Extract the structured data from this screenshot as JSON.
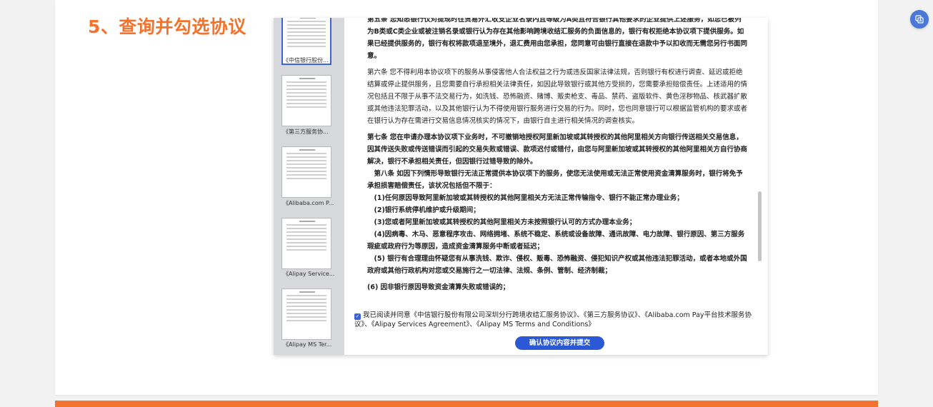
{
  "step": {
    "title": "5、查询并勾选协议"
  },
  "thumbnails": [
    {
      "caption": "《中信银行股份...",
      "selected": true
    },
    {
      "caption": "《第三方服务协...",
      "selected": false
    },
    {
      "caption": "《Alibaba.com P...",
      "selected": false
    },
    {
      "caption": "《Alipay Service...",
      "selected": false
    },
    {
      "caption": "《Alipay MS Ter...",
      "selected": false
    }
  ],
  "document": {
    "paragraphs": [
      {
        "text": "第五条 您知悉银行仅对提现时往贸易外汇收支企业名录内且等级为A类且符合银行其他要求的企业提供上述服务，如您已被列为B类或C类企业或被注销名录或银行认为存在其他影响跨境收结汇服务的负面信息的，银行有权拒绝本协议项下提供服务。如果已经提供服务的，银行有权将款项退至境外，退汇费用由您承担，您同意可由银行直接在退款中予以扣收而无需您另行书面同意。",
        "bold": true
      },
      {
        "text": "第六条 您不得利用本协议项下的服务从事侵害他人合法权益之行为或违反国家法律法规，否则银行有权进行调查、延迟或拒绝结算或停止提供服务，且您需要自行承担相关法律责任，如因此导致银行或其他方受损的，您需要承担赔偿责任。上述适用的情况包括且不限于从事不法交易行为，如洗钱、恐怖融资、赌博、贩卖枪支、毒品、禁药、盗版软件、黄色淫秽物品、核武器扩散或其他违法犯罪活动，以及其他银行认为不得使用银行服务进行交易的行为。同时，您也同意银行可以根据监管机构的要求或者在银行认为存在需进行交易信息情况核实的情况下，由银行自主进行相关情况的调查核实。",
        "bold": false
      },
      {
        "text": "第七条 您在申请办理本协议项下业务时，不可撤销地授权阿里新加坡或其转授权的其他阿里相关方向银行传送相关交易信息，因其传送失败或传送错误而引起的交易失败或错误、款项迟付或错付，由您与阿里新加坡或其转授权的其他阿里相关方自行协商解决，银行不承担相关责任，但因银行过错导致的除外。",
        "bold": true
      },
      {
        "text": "　第八条 如因下列情形导致银行无法正常提供本协议项下的服务，使您无法使用或无法正常使用资金清算服务时，银行将免予承担损害赔偿责任，该状况包括但不限于：",
        "bold": true
      },
      {
        "text": "　(1)任何原因导致阿里新加坡或其转授权的其他阿里相关方无法正常传输指令、银行不能正常办理业务；",
        "bold": true
      },
      {
        "text": "　(2)银行系统停机维护或升级期间；",
        "bold": true
      },
      {
        "text": "　(3)您或者阿里新加坡或其转授权的其他阿里相关方未按照银行认可的方式办理本业务；",
        "bold": true
      },
      {
        "text": "　(4)因病毒、木马、恶意程序攻击、网络拥堵、系统不稳定、系统或设备故障、通讯故障、电力故障、银行原因、第三方服务瑕疵或政府行为等原因，造成资金清算服务中断或者延迟；",
        "bold": true
      },
      {
        "text": "　(5) 银行有合理理由怀疑您有从事洗钱、欺诈、侵权、贩毒、恐怖融资、侵犯知识产权或其他违法犯罪活动，或者本地或外国政府或其他行政机构对您或交易施行之一切法律、法规、条例、管制、经济制裁；",
        "bold": true
      },
      {
        "text": "(6) 因非银行原因导致资金清算失败或错误的；",
        "bold": true
      }
    ]
  },
  "consent": {
    "checked": true,
    "text": "我已阅读并同意《中信银行股份有限公司深圳分行跨境收结汇服务协议》、《第三方服务协议》、《Alibaba.com Pay平台技术服务协议》、《Alipay Services Agreement》、《Alipay MS Terms and Conditions》"
  },
  "confirm_button": {
    "label": "确认协议内容并提交"
  },
  "icons": {
    "float": "translate-icon",
    "check": "check-icon"
  },
  "colors": {
    "accent_orange": "#f2732d",
    "primary_blue": "#2b59d6"
  }
}
